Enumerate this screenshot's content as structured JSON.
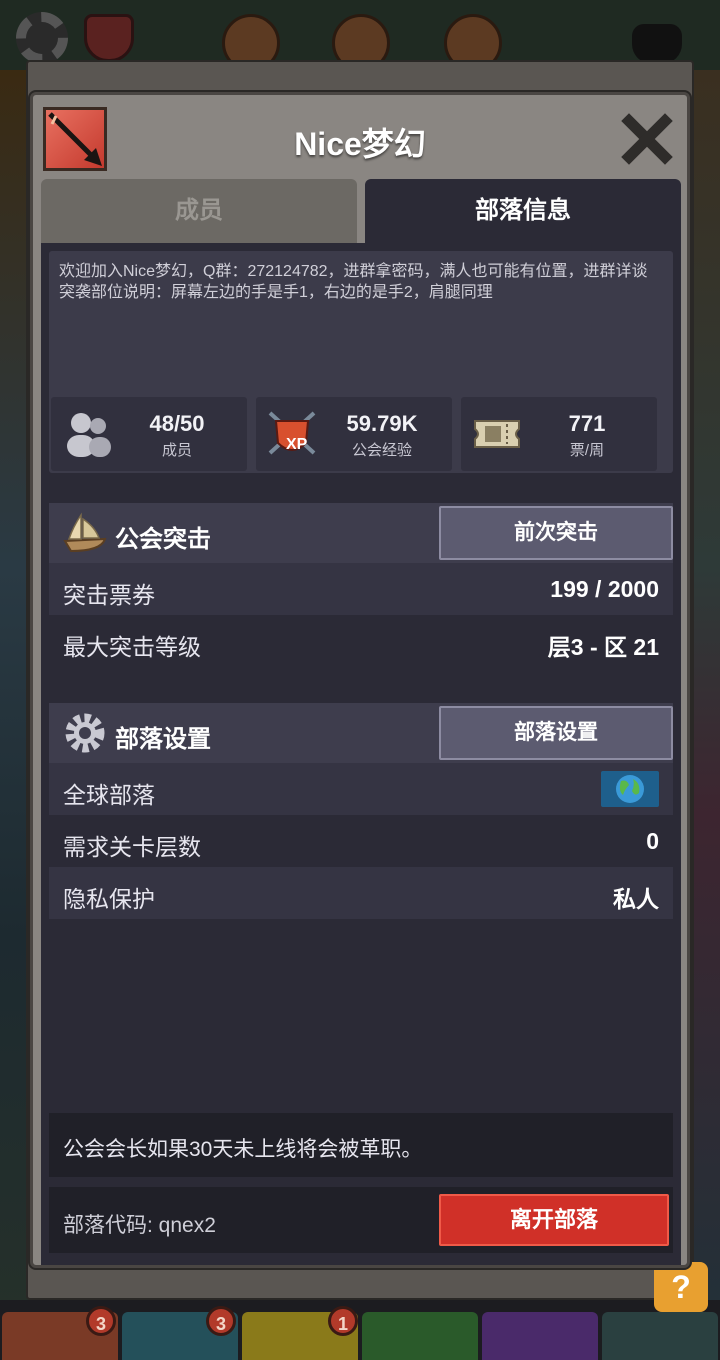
{
  "dialog": {
    "title": "Nice梦幻",
    "icon": "arrow-icon",
    "close_icon": "close-icon"
  },
  "tabs": [
    {
      "label": "成员",
      "active": false
    },
    {
      "label": "部落信息",
      "active": true
    }
  ],
  "description": "欢迎加入Nice梦幻，Q群：272124782，进群拿密码，满人也可能有位置，进群详谈\n突袭部位说明：屏幕左边的手是手1，右边的是手2，肩腿同理",
  "stats": [
    {
      "icon": "members-icon",
      "value": "48/50",
      "label": "成员"
    },
    {
      "icon": "xp-shield-icon",
      "value": "59.79K",
      "label": "公会经验"
    },
    {
      "icon": "ticket-icon",
      "value": "771",
      "label": "票/周"
    }
  ],
  "raid": {
    "title": "公会突击",
    "icon": "ship-icon",
    "button_label": "前次突击",
    "rows": [
      {
        "label": "突击票券",
        "value": "199 / 2000"
      },
      {
        "label": "最大突击等级",
        "value": "层3 - 区 21"
      }
    ]
  },
  "settings": {
    "title": "部落设置",
    "icon": "gear-icon",
    "button_label": "部落设置",
    "rows": [
      {
        "label": "全球部落",
        "value_icon": "globe-icon"
      },
      {
        "label": "需求关卡层数",
        "value": "0"
      },
      {
        "label": "隐私保护",
        "value": "私人"
      }
    ]
  },
  "notice": "公会会长如果30天未上线将会被革职。",
  "footer": {
    "code_text": "部落代码: qnex2",
    "leave_label": "离开部落"
  },
  "background": {
    "badges": [
      "3",
      "3",
      "1"
    ],
    "help_label": "?"
  },
  "colors": {
    "dialog_frame": "#8a8682",
    "panel": "#2b2a36",
    "leave_button": "#d03028",
    "section_button": "#5c5b70"
  }
}
